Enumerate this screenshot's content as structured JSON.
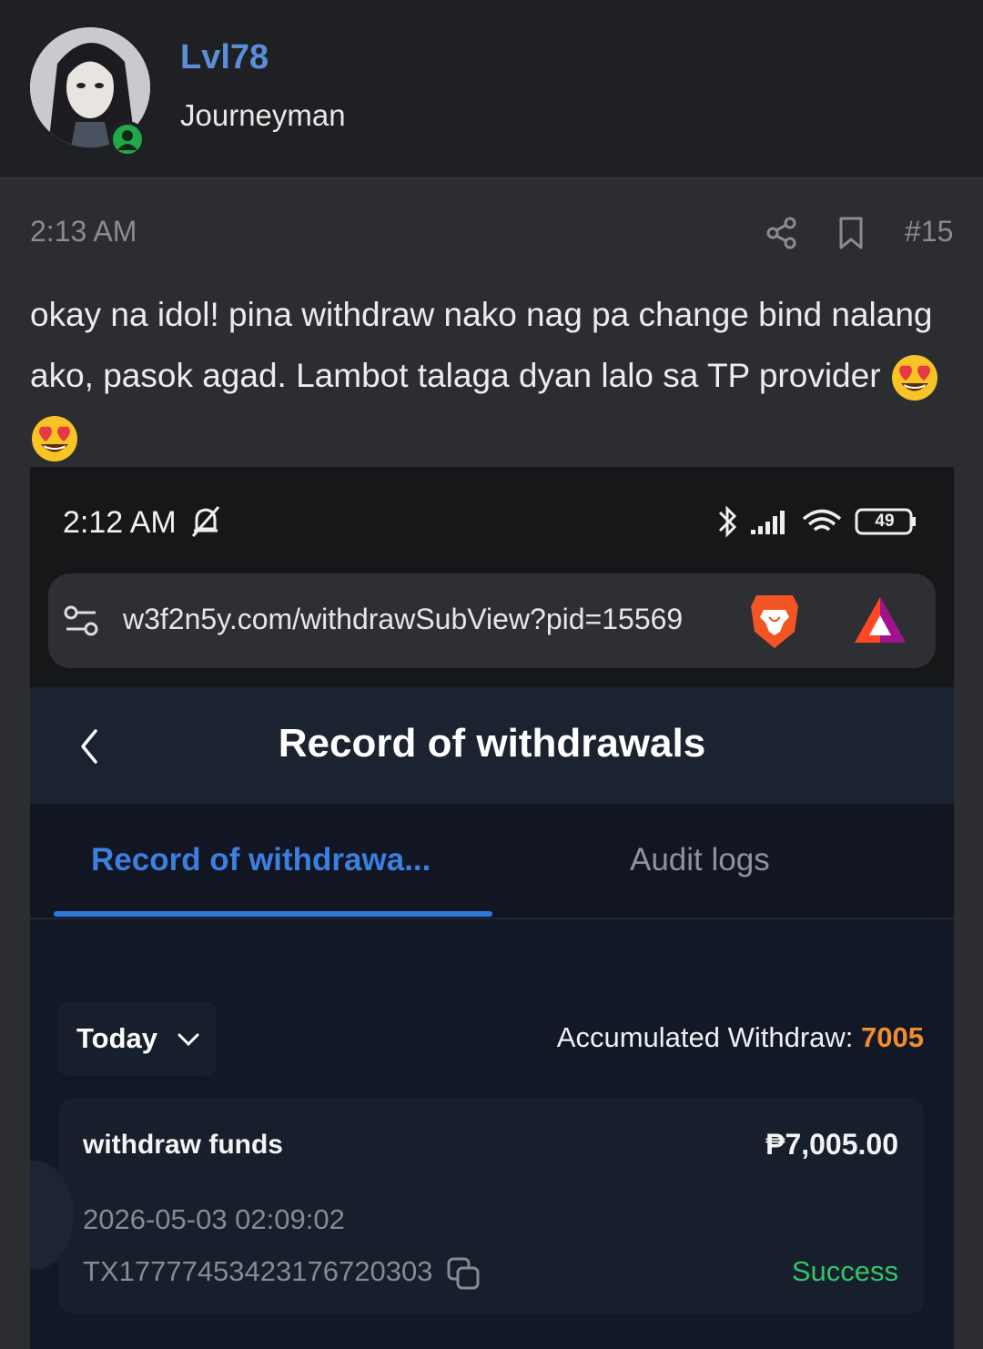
{
  "post": {
    "username": "Lvl78",
    "rank": "Journeyman",
    "time": "2:13 AM",
    "number": "#15",
    "text": "okay na idol! pina withdraw nako nag pa change bind nalang ako, pasok agad. Lambot talaga dyan lalo sa TP provider"
  },
  "phone": {
    "time": "2:12 AM",
    "battery": "49",
    "url": "w3f2n5y.com/withdrawSubView?pid=15569"
  },
  "app": {
    "title": "Record of withdrawals",
    "tabs": [
      "Record of withdrawa...",
      "Audit logs"
    ],
    "filter": "Today",
    "accum_label": "Accumulated Withdraw: ",
    "accum_value": "7005",
    "record": {
      "type": "withdraw funds",
      "amount": "₱7,005.00",
      "date": "2026-05-03 02:09:02",
      "txid": "TX17777453423176720303",
      "status": "Success"
    }
  },
  "colors": {
    "username": "#5a8ed6",
    "active_tab": "#3d7fe0",
    "accum_value": "#f08d2e",
    "success": "#34c468"
  }
}
